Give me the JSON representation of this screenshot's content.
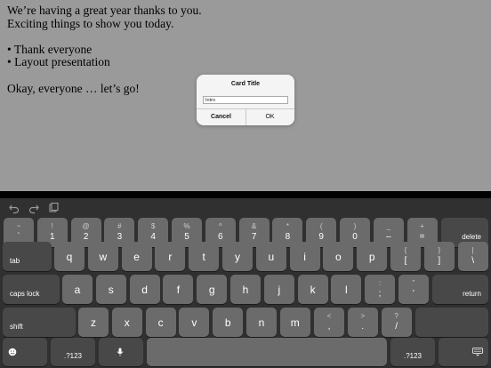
{
  "document": {
    "lines": [
      "We’re having a great year thanks to you.",
      "Exciting things to show you today.",
      "",
      "• Thank everyone",
      "• Layout presentation",
      "",
      "Okay, everyone … let’s go!"
    ]
  },
  "dialog": {
    "title": "Card Title",
    "input_value": "Intro",
    "cancel_label": "Cancel",
    "ok_label": "OK"
  },
  "toolbar": {
    "undo_icon": "undo-icon",
    "redo_icon": "redo-icon",
    "paste_icon": "paste-icon"
  },
  "keyboard": {
    "row1": [
      {
        "top": "~",
        "bottom": "`"
      },
      {
        "top": "!",
        "bottom": "1"
      },
      {
        "top": "@",
        "bottom": "2"
      },
      {
        "top": "#",
        "bottom": "3"
      },
      {
        "top": "$",
        "bottom": "4"
      },
      {
        "top": "%",
        "bottom": "5"
      },
      {
        "top": "^",
        "bottom": "6"
      },
      {
        "top": "&",
        "bottom": "7"
      },
      {
        "top": "*",
        "bottom": "8"
      },
      {
        "top": "(",
        "bottom": "9"
      },
      {
        "top": ")",
        "bottom": "0"
      },
      {
        "top": "_",
        "bottom": "–"
      },
      {
        "top": "+",
        "bottom": "="
      }
    ],
    "delete_label": "delete",
    "tab_label": "tab",
    "row2": [
      "q",
      "w",
      "e",
      "r",
      "t",
      "y",
      "u",
      "i",
      "o",
      "p"
    ],
    "row2_extra": [
      {
        "top": "{",
        "bottom": "["
      },
      {
        "top": "}",
        "bottom": "]"
      },
      {
        "top": "|",
        "bottom": "\\"
      }
    ],
    "caps_label": "caps lock",
    "row3": [
      "a",
      "s",
      "d",
      "f",
      "g",
      "h",
      "j",
      "k",
      "l"
    ],
    "row3_extra": [
      {
        "top": ":",
        "bottom": ";"
      },
      {
        "top": "”",
        "bottom": "’"
      }
    ],
    "return_label": "return",
    "shift_label": "shift",
    "row4": [
      "z",
      "x",
      "c",
      "v",
      "b",
      "n",
      "m"
    ],
    "row4_extra": [
      {
        "top": "<",
        "bottom": ","
      },
      {
        "top": ">",
        "bottom": "."
      },
      {
        "top": "?",
        "bottom": "/"
      }
    ],
    "numbers_label": ".?123",
    "emoji_icon": "emoji-icon",
    "mic_icon": "microphone-icon",
    "hide_keyboard_icon": "hide-keyboard-icon"
  }
}
